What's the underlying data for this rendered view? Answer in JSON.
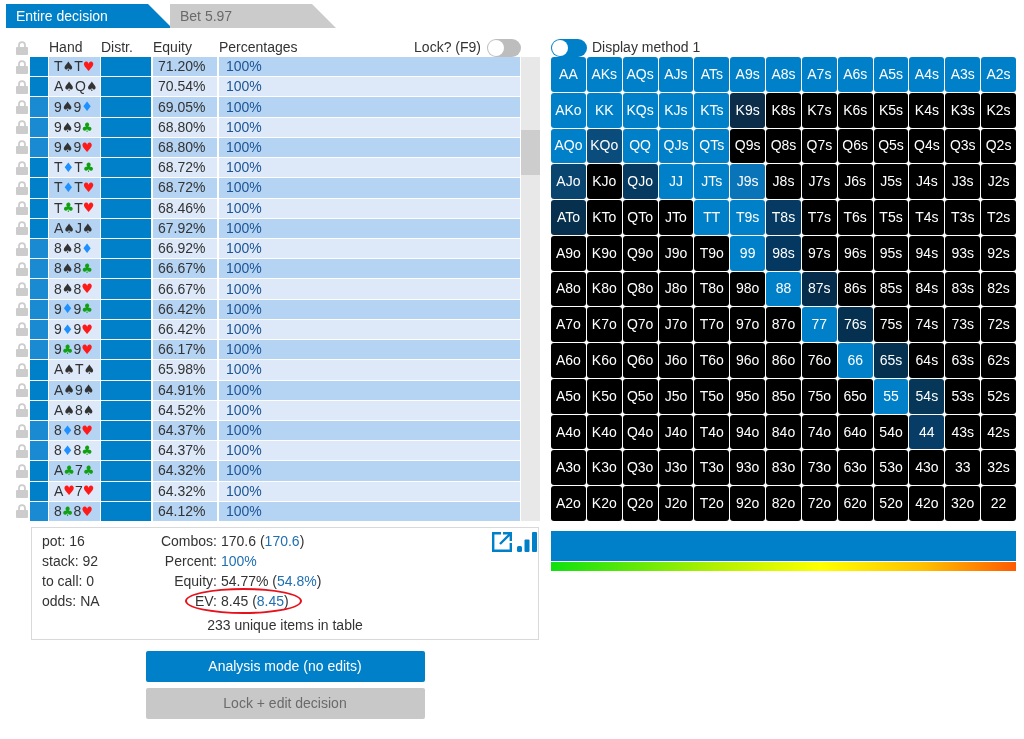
{
  "tabs": [
    {
      "label": "Entire decision",
      "selected": true
    },
    {
      "label": "Bet 5.97",
      "selected": false
    }
  ],
  "table": {
    "columns": [
      "Hand",
      "Distr.",
      "Equity",
      "Percentages"
    ],
    "lock_toggle": {
      "label": "Lock? (F9)",
      "on": false
    },
    "rows": [
      {
        "color": "#0080c8",
        "cards": [
          {
            "rank": "T",
            "suit": "♠",
            "color": "#333333"
          },
          {
            "rank": "T",
            "suit": "♥",
            "color": "#ff1a1a"
          }
        ],
        "level": 1,
        "equity": "71.20%",
        "percentage": "100%"
      },
      {
        "color": "#0080c8",
        "cards": [
          {
            "rank": "A",
            "suit": "♠",
            "color": "#333333"
          },
          {
            "rank": "Q",
            "suit": "♠",
            "color": "#333333"
          }
        ],
        "level": 1,
        "equity": "70.54%",
        "percentage": "100%"
      },
      {
        "color": "#1a8bd2",
        "cards": [
          {
            "rank": "9",
            "suit": "♠",
            "color": "#333333"
          },
          {
            "rank": "9",
            "suit": "♦",
            "color": "#1e90ff"
          }
        ],
        "level": 1,
        "equity": "69.05%",
        "percentage": "100%"
      },
      {
        "color": "#1a8bd2",
        "cards": [
          {
            "rank": "9",
            "suit": "♠",
            "color": "#333333"
          },
          {
            "rank": "9",
            "suit": "♣",
            "color": "#11a011"
          }
        ],
        "level": 1,
        "equity": "68.80%",
        "percentage": "100%"
      },
      {
        "color": "#1a8bd2",
        "cards": [
          {
            "rank": "9",
            "suit": "♠",
            "color": "#333333"
          },
          {
            "rank": "9",
            "suit": "♥",
            "color": "#ff1a1a"
          }
        ],
        "level": 1,
        "equity": "68.80%",
        "percentage": "100%"
      },
      {
        "color": "#0080c8",
        "cards": [
          {
            "rank": "T",
            "suit": "♦",
            "color": "#1e90ff"
          },
          {
            "rank": "T",
            "suit": "♣",
            "color": "#11a011"
          }
        ],
        "level": 1,
        "equity": "68.72%",
        "percentage": "100%"
      },
      {
        "color": "#0080c8",
        "cards": [
          {
            "rank": "T",
            "suit": "♦",
            "color": "#1e90ff"
          },
          {
            "rank": "T",
            "suit": "♥",
            "color": "#ff1a1a"
          }
        ],
        "level": 1,
        "equity": "68.72%",
        "percentage": "100%"
      },
      {
        "color": "#0080c8",
        "cards": [
          {
            "rank": "T",
            "suit": "♣",
            "color": "#11a011"
          },
          {
            "rank": "T",
            "suit": "♥",
            "color": "#ff1a1a"
          }
        ],
        "level": 1,
        "equity": "68.46%",
        "percentage": "100%"
      },
      {
        "color": "#0080c8",
        "cards": [
          {
            "rank": "A",
            "suit": "♠",
            "color": "#333333"
          },
          {
            "rank": "J",
            "suit": "♠",
            "color": "#333333"
          }
        ],
        "level": 1,
        "equity": "67.92%",
        "percentage": "100%"
      },
      {
        "color": "#1a8bd2",
        "cards": [
          {
            "rank": "8",
            "suit": "♠",
            "color": "#333333"
          },
          {
            "rank": "8",
            "suit": "♦",
            "color": "#1e90ff"
          }
        ],
        "level": 1,
        "equity": "66.92%",
        "percentage": "100%"
      },
      {
        "color": "#1a8bd2",
        "cards": [
          {
            "rank": "8",
            "suit": "♠",
            "color": "#333333"
          },
          {
            "rank": "8",
            "suit": "♣",
            "color": "#11a011"
          }
        ],
        "level": 1,
        "equity": "66.67%",
        "percentage": "100%"
      },
      {
        "color": "#1a8bd2",
        "cards": [
          {
            "rank": "8",
            "suit": "♠",
            "color": "#333333"
          },
          {
            "rank": "8",
            "suit": "♥",
            "color": "#ff1a1a"
          }
        ],
        "level": 1,
        "equity": "66.67%",
        "percentage": "100%"
      },
      {
        "color": "#1a8bd2",
        "cards": [
          {
            "rank": "9",
            "suit": "♦",
            "color": "#1e90ff"
          },
          {
            "rank": "9",
            "suit": "♣",
            "color": "#11a011"
          }
        ],
        "level": 1,
        "equity": "66.42%",
        "percentage": "100%"
      },
      {
        "color": "#1a8bd2",
        "cards": [
          {
            "rank": "9",
            "suit": "♦",
            "color": "#1e90ff"
          },
          {
            "rank": "9",
            "suit": "♥",
            "color": "#ff1a1a"
          }
        ],
        "level": 1,
        "equity": "66.42%",
        "percentage": "100%"
      },
      {
        "color": "#1a8bd2",
        "cards": [
          {
            "rank": "9",
            "suit": "♣",
            "color": "#11a011"
          },
          {
            "rank": "9",
            "suit": "♥",
            "color": "#ff1a1a"
          }
        ],
        "level": 1,
        "equity": "66.17%",
        "percentage": "100%"
      },
      {
        "color": "#0080c8",
        "cards": [
          {
            "rank": "A",
            "suit": "♠",
            "color": "#333333"
          },
          {
            "rank": "T",
            "suit": "♠",
            "color": "#333333"
          }
        ],
        "level": 1,
        "equity": "65.98%",
        "percentage": "100%"
      },
      {
        "color": "#0080c8",
        "cards": [
          {
            "rank": "A",
            "suit": "♠",
            "color": "#333333"
          },
          {
            "rank": "9",
            "suit": "♠",
            "color": "#333333"
          }
        ],
        "level": 1,
        "equity": "64.91%",
        "percentage": "100%"
      },
      {
        "color": "#0080c8",
        "cards": [
          {
            "rank": "A",
            "suit": "♠",
            "color": "#333333"
          },
          {
            "rank": "8",
            "suit": "♠",
            "color": "#333333"
          }
        ],
        "level": 1,
        "equity": "64.52%",
        "percentage": "100%"
      },
      {
        "color": "#1a8bd2",
        "cards": [
          {
            "rank": "8",
            "suit": "♦",
            "color": "#1e90ff"
          },
          {
            "rank": "8",
            "suit": "♥",
            "color": "#ff1a1a"
          }
        ],
        "level": 1,
        "equity": "64.37%",
        "percentage": "100%"
      },
      {
        "color": "#1a8bd2",
        "cards": [
          {
            "rank": "8",
            "suit": "♦",
            "color": "#1e90ff"
          },
          {
            "rank": "8",
            "suit": "♣",
            "color": "#11a011"
          }
        ],
        "level": 1,
        "equity": "64.37%",
        "percentage": "100%"
      },
      {
        "color": "#0080c8",
        "cards": [
          {
            "rank": "A",
            "suit": "♣",
            "color": "#11a011"
          },
          {
            "rank": "7",
            "suit": "♣",
            "color": "#11a011"
          }
        ],
        "level": 1,
        "equity": "64.32%",
        "percentage": "100%"
      },
      {
        "color": "#0080c8",
        "cards": [
          {
            "rank": "A",
            "suit": "♥",
            "color": "#ff1a1a"
          },
          {
            "rank": "7",
            "suit": "♥",
            "color": "#ff1a1a"
          }
        ],
        "level": 1,
        "equity": "64.32%",
        "percentage": "100%"
      },
      {
        "color": "#1a8bd2",
        "cards": [
          {
            "rank": "8",
            "suit": "♣",
            "color": "#11a011"
          },
          {
            "rank": "8",
            "suit": "♥",
            "color": "#ff1a1a"
          }
        ],
        "level": 1,
        "equity": "64.12%",
        "percentage": "100%"
      }
    ]
  },
  "summary": {
    "info": [
      "pot: 16",
      "stack: 92",
      "to call: 0",
      "odds: NA"
    ],
    "stats": [
      {
        "label": "Combos:",
        "parts": [
          {
            "text": "170.6 (",
            "accent": false
          },
          {
            "text": "170.6",
            "accent": true
          },
          {
            "text": ")",
            "accent": false
          }
        ],
        "highlighted": false
      },
      {
        "label": "Percent:",
        "parts": [
          {
            "text": "100%",
            "accent": true
          }
        ],
        "highlighted": false
      },
      {
        "label": "Equity:",
        "parts": [
          {
            "text": "54.77% (",
            "accent": false
          },
          {
            "text": "54.8%",
            "accent": true
          },
          {
            "text": ")",
            "accent": false
          }
        ],
        "highlighted": false
      },
      {
        "label": "EV:",
        "parts": [
          {
            "text": "8.45 (",
            "accent": false
          },
          {
            "text": "8.45",
            "accent": true
          },
          {
            "text": ")",
            "accent": false
          }
        ],
        "highlighted": true
      }
    ],
    "footer": "233 unique items in table"
  },
  "buttons": [
    {
      "label": "Analysis mode (no edits)",
      "disabled": false
    },
    {
      "label": "Lock + edit decision",
      "disabled": true
    }
  ],
  "range_panel": {
    "display_toggle": {
      "label": "Display method 1",
      "on": false
    },
    "grid": [
      [
        {
          "label": "AA",
          "color": "#0080c8"
        },
        {
          "label": "AKs",
          "color": "#0080c8"
        },
        {
          "label": "AQs",
          "color": "#0080c8"
        },
        {
          "label": "AJs",
          "color": "#0080c8"
        },
        {
          "label": "ATs",
          "color": "#0080c8"
        },
        {
          "label": "A9s",
          "color": "#0080c8"
        },
        {
          "label": "A8s",
          "color": "#0080c8"
        },
        {
          "label": "A7s",
          "color": "#0080c8"
        },
        {
          "label": "A6s",
          "color": "#0080c8"
        },
        {
          "label": "A5s",
          "color": "#0080c8"
        },
        {
          "label": "A4s",
          "color": "#0080c8"
        },
        {
          "label": "A3s",
          "color": "#0080c8"
        },
        {
          "label": "A2s",
          "color": "#0080c8"
        }
      ],
      [
        {
          "label": "AKo",
          "color": "#0080c8"
        },
        {
          "label": "KK",
          "color": "#0080c8"
        },
        {
          "label": "KQs",
          "color": "#0080c8"
        },
        {
          "label": "KJs",
          "color": "#0080c8"
        },
        {
          "label": "KTs",
          "color": "#0080c8"
        },
        {
          "label": "K9s",
          "color": "#0b2d4a"
        },
        {
          "label": "K8s",
          "color": "#000000"
        },
        {
          "label": "K7s",
          "color": "#000000"
        },
        {
          "label": "K6s",
          "color": "#000000"
        },
        {
          "label": "K5s",
          "color": "#000000"
        },
        {
          "label": "K4s",
          "color": "#000000"
        },
        {
          "label": "K3s",
          "color": "#000000"
        },
        {
          "label": "K2s",
          "color": "#000000"
        }
      ],
      [
        {
          "label": "AQo",
          "color": "#0080c8"
        },
        {
          "label": "KQo",
          "color": "#0a4c7c"
        },
        {
          "label": "QQ",
          "color": "#0080c8"
        },
        {
          "label": "QJs",
          "color": "#0080c8"
        },
        {
          "label": "QTs",
          "color": "#0080c8"
        },
        {
          "label": "Q9s",
          "color": "#000000"
        },
        {
          "label": "Q8s",
          "color": "#000000"
        },
        {
          "label": "Q7s",
          "color": "#000000"
        },
        {
          "label": "Q6s",
          "color": "#000000"
        },
        {
          "label": "Q5s",
          "color": "#000000"
        },
        {
          "label": "Q4s",
          "color": "#000000"
        },
        {
          "label": "Q3s",
          "color": "#000000"
        },
        {
          "label": "Q2s",
          "color": "#000000"
        }
      ],
      [
        {
          "label": "AJo",
          "color": "#0a4570"
        },
        {
          "label": "KJo",
          "color": "#000000"
        },
        {
          "label": "QJo",
          "color": "#073a60"
        },
        {
          "label": "JJ",
          "color": "#0080c8"
        },
        {
          "label": "JTs",
          "color": "#0080c8"
        },
        {
          "label": "J9s",
          "color": "#0a74b8"
        },
        {
          "label": "J8s",
          "color": "#000000"
        },
        {
          "label": "J7s",
          "color": "#000000"
        },
        {
          "label": "J6s",
          "color": "#000000"
        },
        {
          "label": "J5s",
          "color": "#000000"
        },
        {
          "label": "J4s",
          "color": "#000000"
        },
        {
          "label": "J3s",
          "color": "#000000"
        },
        {
          "label": "J2s",
          "color": "#000000"
        }
      ],
      [
        {
          "label": "ATo",
          "color": "#07304f"
        },
        {
          "label": "KTo",
          "color": "#000000"
        },
        {
          "label": "QTo",
          "color": "#000000"
        },
        {
          "label": "JTo",
          "color": "#000000"
        },
        {
          "label": "TT",
          "color": "#0080c8"
        },
        {
          "label": "T9s",
          "color": "#0080c8"
        },
        {
          "label": "T8s",
          "color": "#063a62"
        },
        {
          "label": "T7s",
          "color": "#000000"
        },
        {
          "label": "T6s",
          "color": "#000000"
        },
        {
          "label": "T5s",
          "color": "#000000"
        },
        {
          "label": "T4s",
          "color": "#000000"
        },
        {
          "label": "T3s",
          "color": "#000000"
        },
        {
          "label": "T2s",
          "color": "#000000"
        }
      ],
      [
        {
          "label": "A9o",
          "color": "#000000"
        },
        {
          "label": "K9o",
          "color": "#000000"
        },
        {
          "label": "Q9o",
          "color": "#000000"
        },
        {
          "label": "J9o",
          "color": "#000000"
        },
        {
          "label": "T9o",
          "color": "#000000"
        },
        {
          "label": "99",
          "color": "#0080c8"
        },
        {
          "label": "98s",
          "color": "#053860"
        },
        {
          "label": "97s",
          "color": "#000000"
        },
        {
          "label": "96s",
          "color": "#000000"
        },
        {
          "label": "95s",
          "color": "#000000"
        },
        {
          "label": "94s",
          "color": "#000000"
        },
        {
          "label": "93s",
          "color": "#000000"
        },
        {
          "label": "92s",
          "color": "#000000"
        }
      ],
      [
        {
          "label": "A8o",
          "color": "#000000"
        },
        {
          "label": "K8o",
          "color": "#000000"
        },
        {
          "label": "Q8o",
          "color": "#000000"
        },
        {
          "label": "J8o",
          "color": "#000000"
        },
        {
          "label": "T8o",
          "color": "#000000"
        },
        {
          "label": "98o",
          "color": "#000000"
        },
        {
          "label": "88",
          "color": "#0080c8"
        },
        {
          "label": "87s",
          "color": "#052c4a"
        },
        {
          "label": "86s",
          "color": "#000000"
        },
        {
          "label": "85s",
          "color": "#000000"
        },
        {
          "label": "84s",
          "color": "#000000"
        },
        {
          "label": "83s",
          "color": "#000000"
        },
        {
          "label": "82s",
          "color": "#000000"
        }
      ],
      [
        {
          "label": "A7o",
          "color": "#000000"
        },
        {
          "label": "K7o",
          "color": "#000000"
        },
        {
          "label": "Q7o",
          "color": "#000000"
        },
        {
          "label": "J7o",
          "color": "#000000"
        },
        {
          "label": "T7o",
          "color": "#000000"
        },
        {
          "label": "97o",
          "color": "#000000"
        },
        {
          "label": "87o",
          "color": "#000000"
        },
        {
          "label": "77",
          "color": "#0080c8"
        },
        {
          "label": "76s",
          "color": "#06304f"
        },
        {
          "label": "75s",
          "color": "#000000"
        },
        {
          "label": "74s",
          "color": "#000000"
        },
        {
          "label": "73s",
          "color": "#000000"
        },
        {
          "label": "72s",
          "color": "#000000"
        }
      ],
      [
        {
          "label": "A6o",
          "color": "#000000"
        },
        {
          "label": "K6o",
          "color": "#000000"
        },
        {
          "label": "Q6o",
          "color": "#000000"
        },
        {
          "label": "J6o",
          "color": "#000000"
        },
        {
          "label": "T6o",
          "color": "#000000"
        },
        {
          "label": "96o",
          "color": "#000000"
        },
        {
          "label": "86o",
          "color": "#000000"
        },
        {
          "label": "76o",
          "color": "#000000"
        },
        {
          "label": "66",
          "color": "#0080c8"
        },
        {
          "label": "65s",
          "color": "#06304f"
        },
        {
          "label": "64s",
          "color": "#000000"
        },
        {
          "label": "63s",
          "color": "#000000"
        },
        {
          "label": "62s",
          "color": "#000000"
        }
      ],
      [
        {
          "label": "A5o",
          "color": "#000000"
        },
        {
          "label": "K5o",
          "color": "#000000"
        },
        {
          "label": "Q5o",
          "color": "#000000"
        },
        {
          "label": "J5o",
          "color": "#000000"
        },
        {
          "label": "T5o",
          "color": "#000000"
        },
        {
          "label": "95o",
          "color": "#000000"
        },
        {
          "label": "85o",
          "color": "#000000"
        },
        {
          "label": "75o",
          "color": "#000000"
        },
        {
          "label": "65o",
          "color": "#000000"
        },
        {
          "label": "55",
          "color": "#0080c8"
        },
        {
          "label": "54s",
          "color": "#063658"
        },
        {
          "label": "53s",
          "color": "#000000"
        },
        {
          "label": "52s",
          "color": "#000000"
        }
      ],
      [
        {
          "label": "A4o",
          "color": "#000000"
        },
        {
          "label": "K4o",
          "color": "#000000"
        },
        {
          "label": "Q4o",
          "color": "#000000"
        },
        {
          "label": "J4o",
          "color": "#000000"
        },
        {
          "label": "T4o",
          "color": "#000000"
        },
        {
          "label": "94o",
          "color": "#000000"
        },
        {
          "label": "84o",
          "color": "#000000"
        },
        {
          "label": "74o",
          "color": "#000000"
        },
        {
          "label": "64o",
          "color": "#000000"
        },
        {
          "label": "54o",
          "color": "#000000"
        },
        {
          "label": "44",
          "color": "#073c66"
        },
        {
          "label": "43s",
          "color": "#000000"
        },
        {
          "label": "42s",
          "color": "#000000"
        }
      ],
      [
        {
          "label": "A3o",
          "color": "#000000"
        },
        {
          "label": "K3o",
          "color": "#000000"
        },
        {
          "label": "Q3o",
          "color": "#000000"
        },
        {
          "label": "J3o",
          "color": "#000000"
        },
        {
          "label": "T3o",
          "color": "#000000"
        },
        {
          "label": "93o",
          "color": "#000000"
        },
        {
          "label": "83o",
          "color": "#000000"
        },
        {
          "label": "73o",
          "color": "#000000"
        },
        {
          "label": "63o",
          "color": "#000000"
        },
        {
          "label": "53o",
          "color": "#000000"
        },
        {
          "label": "43o",
          "color": "#000000"
        },
        {
          "label": "33",
          "color": "#000000"
        },
        {
          "label": "32s",
          "color": "#000000"
        }
      ],
      [
        {
          "label": "A2o",
          "color": "#000000"
        },
        {
          "label": "K2o",
          "color": "#000000"
        },
        {
          "label": "Q2o",
          "color": "#000000"
        },
        {
          "label": "J2o",
          "color": "#000000"
        },
        {
          "label": "T2o",
          "color": "#000000"
        },
        {
          "label": "92o",
          "color": "#000000"
        },
        {
          "label": "82o",
          "color": "#000000"
        },
        {
          "label": "72o",
          "color": "#000000"
        },
        {
          "label": "62o",
          "color": "#000000"
        },
        {
          "label": "52o",
          "color": "#000000"
        },
        {
          "label": "42o",
          "color": "#000000"
        },
        {
          "label": "32o",
          "color": "#000000"
        },
        {
          "label": "22",
          "color": "#000000"
        }
      ]
    ],
    "strategy_bar": {
      "level": 1
    }
  }
}
